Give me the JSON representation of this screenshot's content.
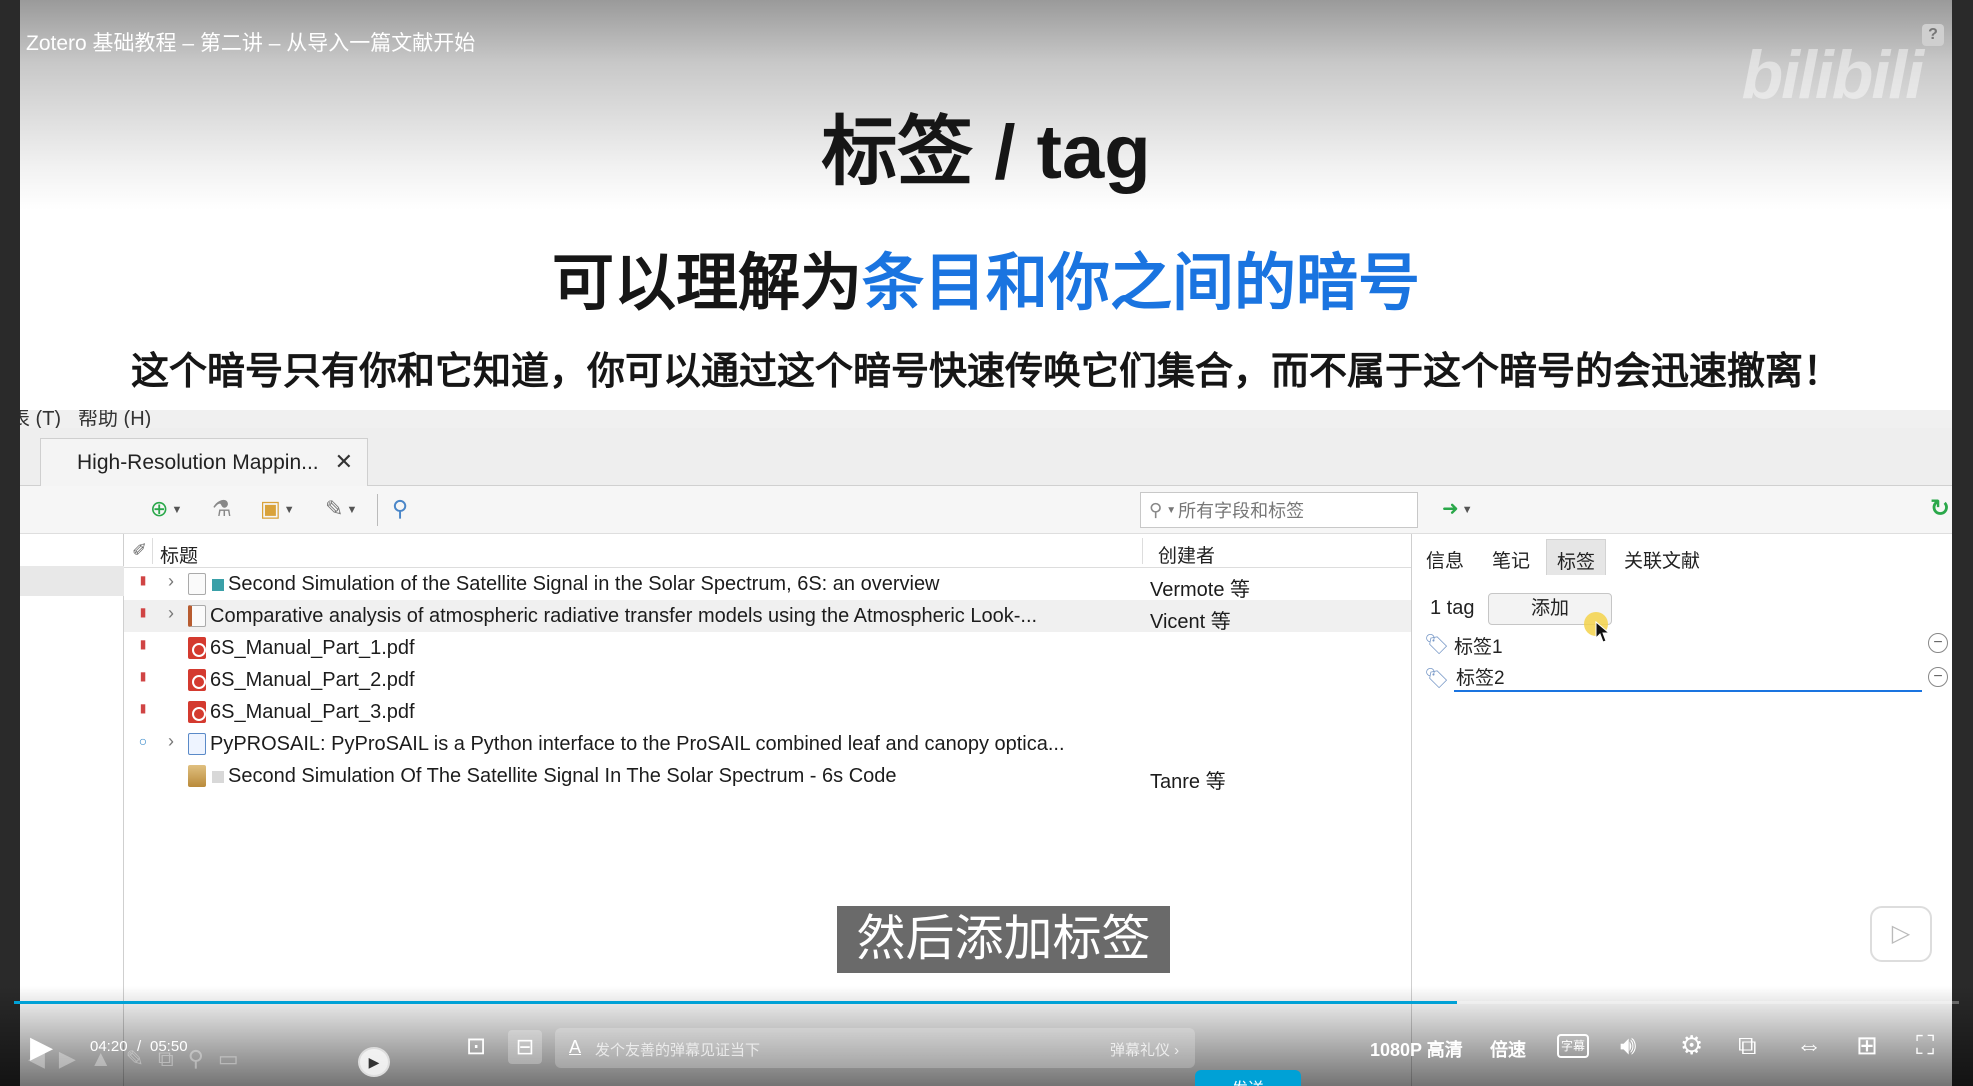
{
  "video": {
    "title": "Zotero 基础教程 – 第二讲 – 从导入一篇文献开始",
    "help": "?",
    "logo": "bilibili",
    "subtitle": "然后添加标签"
  },
  "slide": {
    "heading": "标签 / tag",
    "subheading_plain": "可以理解为",
    "subheading_highlight": "条目和你之间的暗号",
    "body": "这个暗号只有你和它知道，你可以通过这个暗号快速传唤它们集合，而不属于这个暗号的会迅速撤离！"
  },
  "zotero": {
    "menu": [
      "表 (T)",
      "帮助 (H)"
    ],
    "tab": {
      "label": "High-Resolution Mappin...",
      "close": "✕"
    },
    "search": {
      "placeholder": "所有字段和标签"
    },
    "columns": {
      "title": "标题",
      "creator": "创建者"
    },
    "items": [
      {
        "title": "Second Simulation of the Satellite Signal in the Solar Spectrum, 6S: an overview",
        "creator": "Vermote 等",
        "type": "document",
        "color": "#3aa0a8"
      },
      {
        "title": "Comparative analysis of atmospheric radiative transfer models using the Atmospheric Look-...",
        "creator": "Vicent 等",
        "type": "report",
        "color": ""
      },
      {
        "title": "6S_Manual_Part_1.pdf",
        "creator": "",
        "type": "pdf",
        "color": ""
      },
      {
        "title": "6S_Manual_Part_2.pdf",
        "creator": "",
        "type": "pdf",
        "color": ""
      },
      {
        "title": "6S_Manual_Part_3.pdf",
        "creator": "",
        "type": "pdf",
        "color": ""
      },
      {
        "title": "PyPROSAIL: PyProSAIL is a Python interface to the ProSAIL combined leaf and canopy optica...",
        "creator": "",
        "type": "web",
        "color": ""
      },
      {
        "title": "Second Simulation Of The Satellite Signal In The Solar Spectrum - 6s Code",
        "creator": "Tanre 等",
        "type": "book",
        "color": "#d8d8d8"
      }
    ],
    "item_tabs": [
      "信息",
      "笔记",
      "标签",
      "关联文献"
    ],
    "active_tab": "标签",
    "tag_count": "1 tag",
    "add_button": "添加",
    "tags": [
      "标签1"
    ],
    "tag_editing_value": "标签2"
  },
  "player": {
    "time_current": "04:20",
    "time_separator": "/",
    "time_total": "05:50",
    "progress": 0.742,
    "danmaku_placeholder": "发个友善的弹幕见证当下",
    "danmaku_gift": "弹幕礼仪 ›",
    "send": "发送",
    "quality": "1080P 高清",
    "speed": "倍速",
    "caption": "字幕",
    "accent_color": "#00a1d6"
  }
}
